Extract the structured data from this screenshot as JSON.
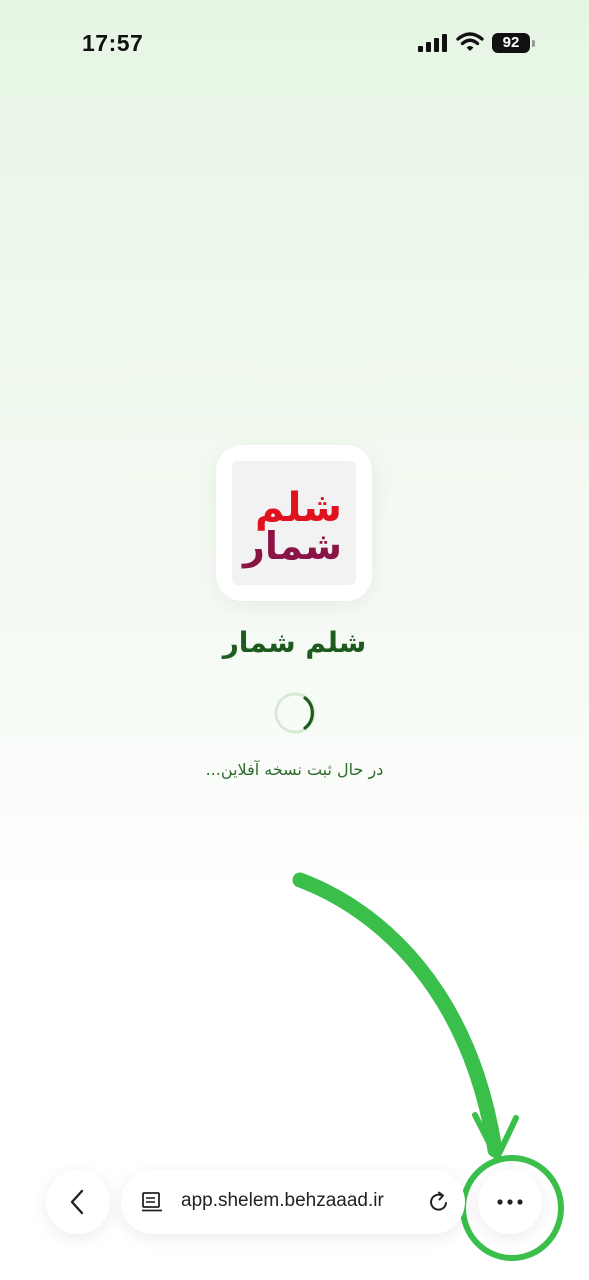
{
  "status_bar": {
    "time": "17:57",
    "battery": "92",
    "icons": [
      "signal-icon",
      "wifi-icon",
      "battery-icon"
    ]
  },
  "splash": {
    "logo_text_top": "شلم",
    "logo_text_bottom": "شمار",
    "app_name": "شلم شمار",
    "loading_text": "در حال ثبت نسخه آفلاین..."
  },
  "browser_bar": {
    "url": "app.shelem.behzaaad.ir",
    "icons": [
      "back-icon",
      "page-icon",
      "reload-icon",
      "more-icon"
    ]
  },
  "colors": {
    "brand_green": "#1e5b1e",
    "logo_red": "#e0121e",
    "logo_maroon": "#8a1446",
    "annotation_green": "#3bbf4b"
  }
}
